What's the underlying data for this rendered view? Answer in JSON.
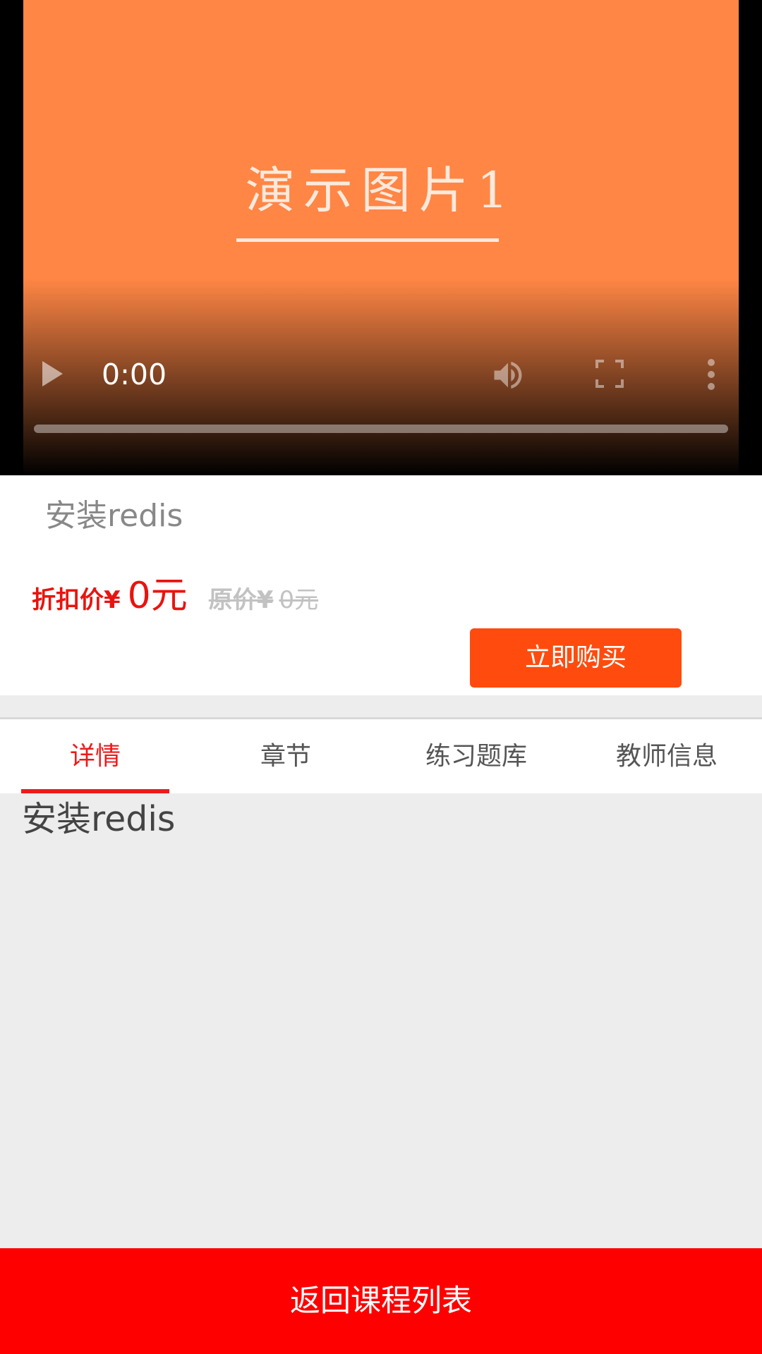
{
  "video": {
    "poster_text": "演示图片1",
    "time": "0:00",
    "progress": 0,
    "icons": {
      "play": "play-icon",
      "volume": "volume-icon",
      "fullscreen": "fullscreen-icon",
      "more": "more-vertical-icon"
    }
  },
  "course": {
    "title": "安装redis",
    "discount_label": "折扣价¥",
    "discount_value": "0元",
    "original_label": "原价¥",
    "original_value": "0元",
    "buy_label": "立即购买"
  },
  "tabs": [
    {
      "label": "详情",
      "active": true
    },
    {
      "label": "章节",
      "active": false
    },
    {
      "label": "练习题库",
      "active": false
    },
    {
      "label": "教师信息",
      "active": false
    }
  ],
  "detail": {
    "text": "安装redis"
  },
  "footer": {
    "back_label": "返回课程列表"
  },
  "colors": {
    "poster_bg": "#ff8645",
    "buy_button": "#ff4b0e",
    "accent_red": "#ee1a1a",
    "footer_bg": "#ff0000"
  }
}
